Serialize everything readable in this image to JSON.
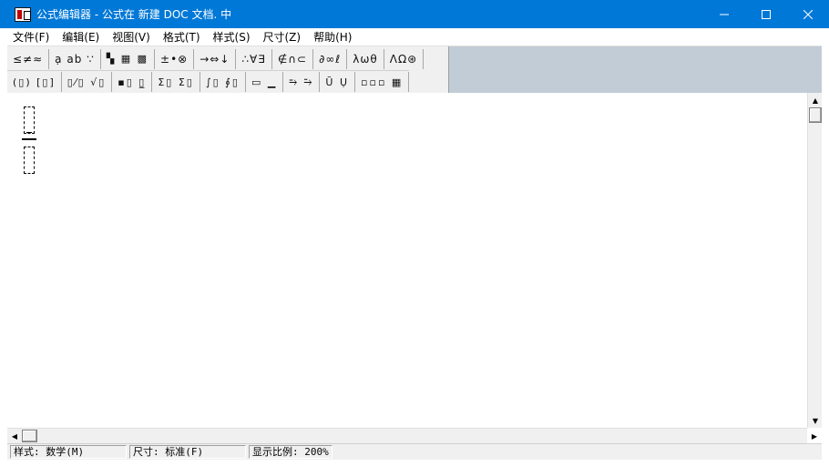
{
  "window": {
    "title": "公式编辑器 - 公式在 新建 DOC 文档. 中",
    "accent_color": "#0078d7",
    "controls": [
      "minimize-icon",
      "maximize-icon",
      "close-icon"
    ]
  },
  "menu": {
    "items": [
      {
        "label": "文件(F)"
      },
      {
        "label": "编辑(E)"
      },
      {
        "label": "视图(V)"
      },
      {
        "label": "格式(T)"
      },
      {
        "label": "样式(S)"
      },
      {
        "label": "尺寸(Z)"
      },
      {
        "label": "帮助(H)"
      }
    ]
  },
  "toolbar": {
    "row1": [
      {
        "label": "≤≠≈"
      },
      {
        "label": "ạ ab ∵"
      },
      {
        "label": "▚ ▦ ▩"
      },
      {
        "label": "±•⊗"
      },
      {
        "label": "→⇔↓"
      },
      {
        "label": "∴∀∃"
      },
      {
        "label": "∉∩⊂"
      },
      {
        "label": "∂∞ℓ"
      },
      {
        "label": "λωθ"
      },
      {
        "label": "ΛΩ⊛"
      }
    ],
    "row2": [
      {
        "label": "(▯) [▯]"
      },
      {
        "label": "▯⁄▯ √▯"
      },
      {
        "label": "▪▯ ▯̲"
      },
      {
        "label": "Σ▯ Σ▯"
      },
      {
        "label": "∫▯ ∮▯"
      },
      {
        "label": "▭ ▁"
      },
      {
        "label": "⥱ ⥲"
      },
      {
        "label": "Ũ Ụ"
      },
      {
        "label": "▫▫▫ ▦"
      }
    ]
  },
  "status": {
    "style": "样式: 数学(M)",
    "size": "尺寸: 标准(F)",
    "zoom": "显示比例: 200%"
  }
}
